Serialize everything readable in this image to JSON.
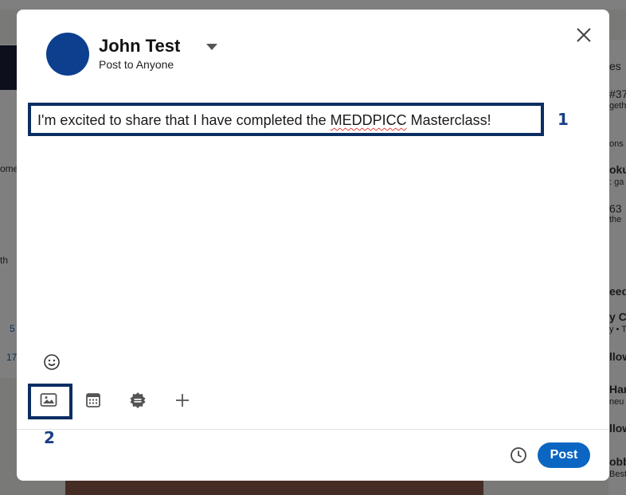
{
  "background": {
    "left_snippets": [
      "ome",
      "th",
      "5",
      "17"
    ],
    "right_snippets": [
      "es",
      "#37",
      "geth",
      "ons",
      "oku",
      ": ga",
      "63",
      "the",
      "eed",
      "y Cr",
      "y • T",
      "llow",
      "Har",
      "neu",
      "llow",
      "obb",
      "Best"
    ]
  },
  "composer": {
    "author_name": "John Test",
    "visibility_label": "Post to Anyone",
    "text_before": "I'm excited to share that I have completed the ",
    "text_misspelled": "MEDDPICC",
    "text_after": " Masterclass!",
    "post_label": "Post",
    "brand_color": "#0a66c2",
    "highlight_color": "#0b2e62"
  },
  "annotations": {
    "callout_1": "1",
    "callout_2": "2"
  },
  "icons": [
    "close-icon",
    "chevron-down-icon",
    "smiley-icon",
    "image-icon",
    "calendar-icon",
    "badge-icon",
    "plus-icon",
    "clock-icon"
  ]
}
